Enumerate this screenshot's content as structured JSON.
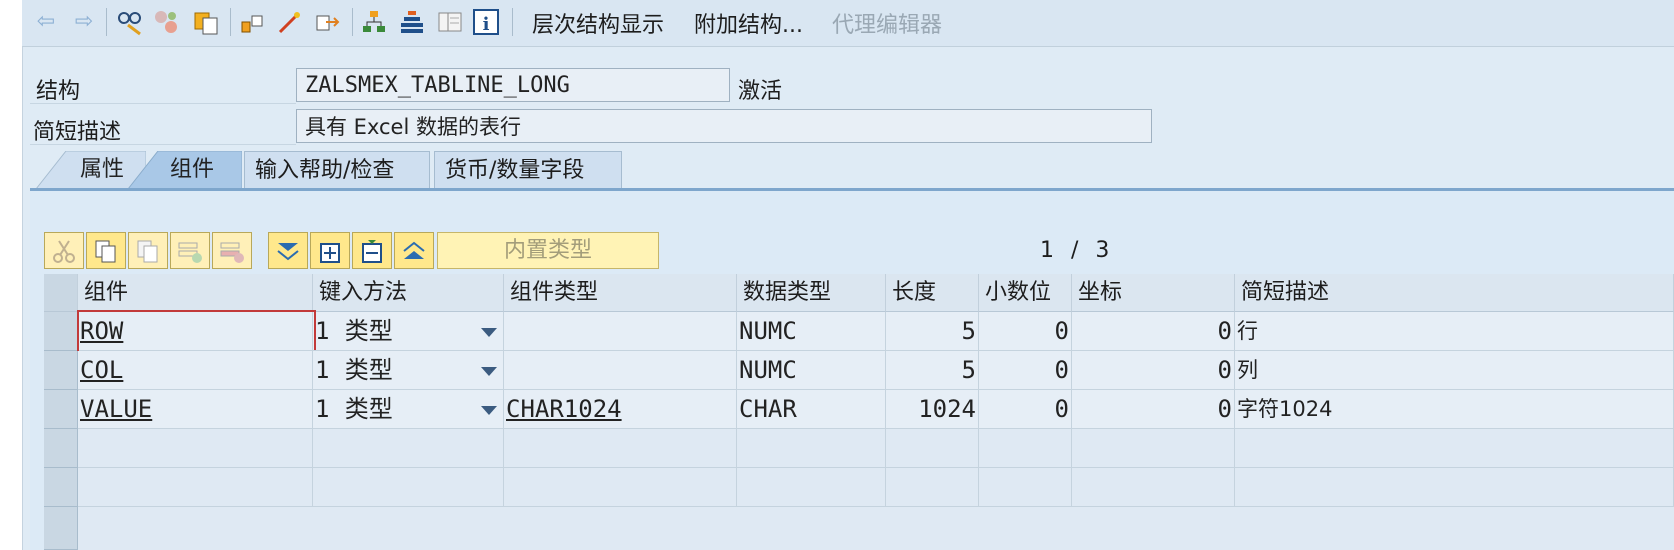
{
  "toolbar": {
    "icons": [
      "back-arrow-icon",
      "forward-arrow-icon",
      "where-used-icon",
      "other-object-icon",
      "copy-object-icon",
      "hierarchy-icon",
      "magic-wand-icon",
      "export-icon",
      "tree-icon",
      "layers-icon",
      "list-view-icon",
      "info-icon"
    ],
    "hierarchy_display": "层次结构显示",
    "append_structure": "附加结构...",
    "proxy_editor": "代理编辑器"
  },
  "header": {
    "structure_label": "结构",
    "structure_value": "ZALSMEX_TABLINE_LONG",
    "status": "激活",
    "short_desc_label": "简短描述",
    "short_desc_value": "具有 Excel 数据的表行"
  },
  "tabs": [
    {
      "label": "属性",
      "active": false
    },
    {
      "label": "组件",
      "active": true
    },
    {
      "label": "输入帮助/检查",
      "active": false
    },
    {
      "label": "货币/数量字段",
      "active": false
    }
  ],
  "grid_toolbar": {
    "builtin_type": "内置类型",
    "pager_current": "1",
    "pager_sep": "/",
    "pager_total": "3"
  },
  "columns": [
    "组件",
    "键入方法",
    "组件类型",
    "数据类型",
    "长度",
    "小数位",
    "坐标",
    "简短描述"
  ],
  "rows": [
    {
      "component": "ROW",
      "key_num": "1",
      "key_type": "类型",
      "comp_type": "",
      "data_type": "NUMC",
      "length": "5",
      "decimals": "0",
      "coord": "0",
      "desc": "行"
    },
    {
      "component": "COL",
      "key_num": "1",
      "key_type": "类型",
      "comp_type": "",
      "data_type": "NUMC",
      "length": "5",
      "decimals": "0",
      "coord": "0",
      "desc": "列"
    },
    {
      "component": "VALUE",
      "key_num": "1",
      "key_type": "类型",
      "comp_type": "CHAR1024",
      "data_type": "CHAR",
      "length": "1024",
      "decimals": "0",
      "coord": "0",
      "desc": "字符1024"
    }
  ],
  "colors": {
    "accent": "#7ea6cc",
    "button": "#ffe88c",
    "background": "#dfebf5"
  }
}
